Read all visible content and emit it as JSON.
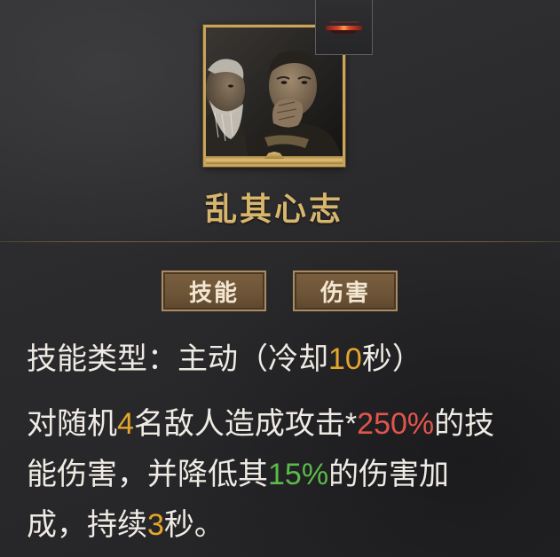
{
  "skill": {
    "name": "乱其心志",
    "portrait_icon": "two-elders-portrait",
    "badge_icon": "red-bar-emblem-icon"
  },
  "tags": [
    {
      "label": "技能"
    },
    {
      "label": "伤害"
    }
  ],
  "skill_type": {
    "label": "技能类型：主动（冷却",
    "cooldown": "10",
    "suffix": "秒）"
  },
  "description": {
    "lines": [
      [
        "对随机",
        "4",
        "名敌人造成攻击*",
        "250%",
        "的技"
      ],
      [
        "能伤害，并降低其",
        "15%",
        "的伤害加"
      ],
      [
        "成，持续",
        "3",
        "秒。"
      ]
    ]
  },
  "colors": {
    "title": "#d8b56c",
    "text": "#efebe4",
    "highlight": "#e6a52b",
    "damage": "#e2554c",
    "debuff": "#5cb94b",
    "tag_bg": "#6d5437",
    "frame": "#c9a45a"
  }
}
